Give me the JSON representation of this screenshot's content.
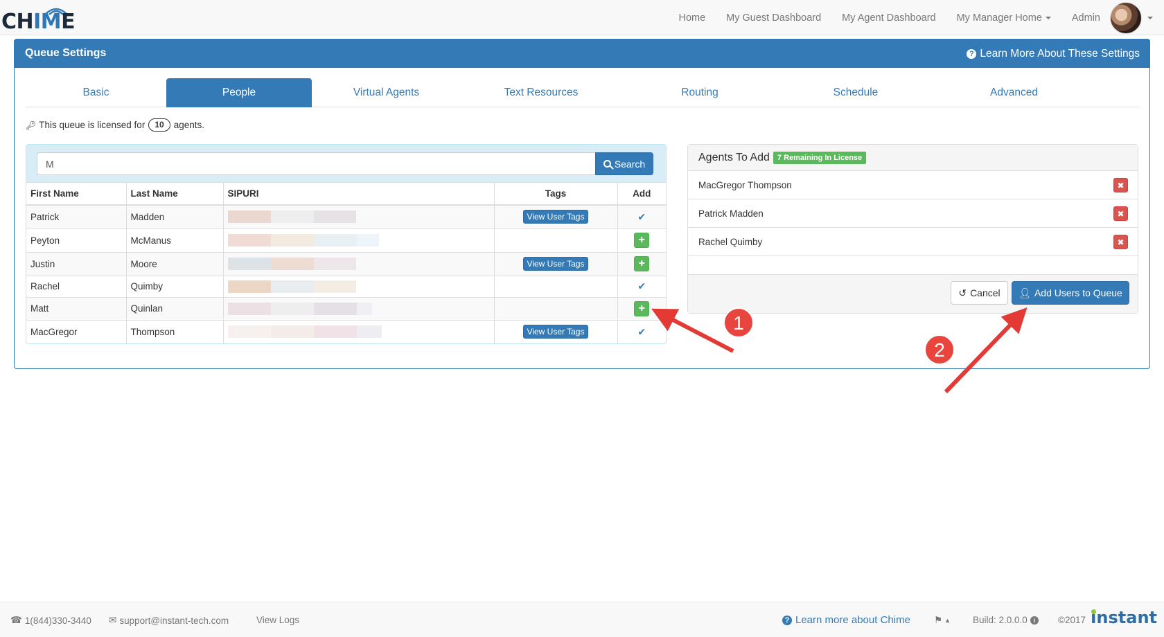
{
  "app": {
    "logo_text_pre": "CH",
    "logo_text_m": "IM",
    "logo_text_post": "E"
  },
  "nav": {
    "items": [
      {
        "label": "Home"
      },
      {
        "label": "My Guest Dashboard"
      },
      {
        "label": "My Agent Dashboard"
      },
      {
        "label": "My Manager Home"
      },
      {
        "label": "Admin"
      }
    ]
  },
  "panel": {
    "title": "Queue Settings",
    "learn_more": "Learn More About These Settings"
  },
  "tabs": [
    {
      "label": "Basic"
    },
    {
      "label": "People"
    },
    {
      "label": "Virtual Agents"
    },
    {
      "label": "Text Resources"
    },
    {
      "label": "Routing"
    },
    {
      "label": "Schedule"
    },
    {
      "label": "Advanced"
    }
  ],
  "license": {
    "prefix": "This queue is licensed for",
    "count": "10",
    "suffix": "agents."
  },
  "search": {
    "value": "M",
    "button": "Search"
  },
  "table": {
    "headers": {
      "first": "First Name",
      "last": "Last Name",
      "sip": "SIPURI",
      "tags": "Tags",
      "add": "Add"
    },
    "view_tags_label": "View User Tags",
    "rows": [
      {
        "first": "Patrick",
        "last": "Madden"
      },
      {
        "first": "Peyton",
        "last": "McManus"
      },
      {
        "first": "Justin",
        "last": "Moore"
      },
      {
        "first": "Rachel",
        "last": "Quimby"
      },
      {
        "first": "Matt",
        "last": "Quinlan"
      },
      {
        "first": "MacGregor",
        "last": "Thompson"
      }
    ]
  },
  "agents_to_add": {
    "title": "Agents To Add",
    "badge": "7 Remaining In License",
    "agents": [
      {
        "name": "MacGregor Thompson"
      },
      {
        "name": "Patrick Madden"
      },
      {
        "name": "Rachel Quimby"
      }
    ],
    "cancel": "Cancel",
    "add_button": "Add Users to Queue"
  },
  "annotations": {
    "one": "1",
    "two": "2"
  },
  "footer": {
    "phone": "1(844)330-3440",
    "email": "support@instant-tech.com",
    "view_logs": "View Logs",
    "learn_more": "Learn more about Chime",
    "build": "Build: 2.0.0.0",
    "copyright": "©2017",
    "brand": "instant"
  }
}
